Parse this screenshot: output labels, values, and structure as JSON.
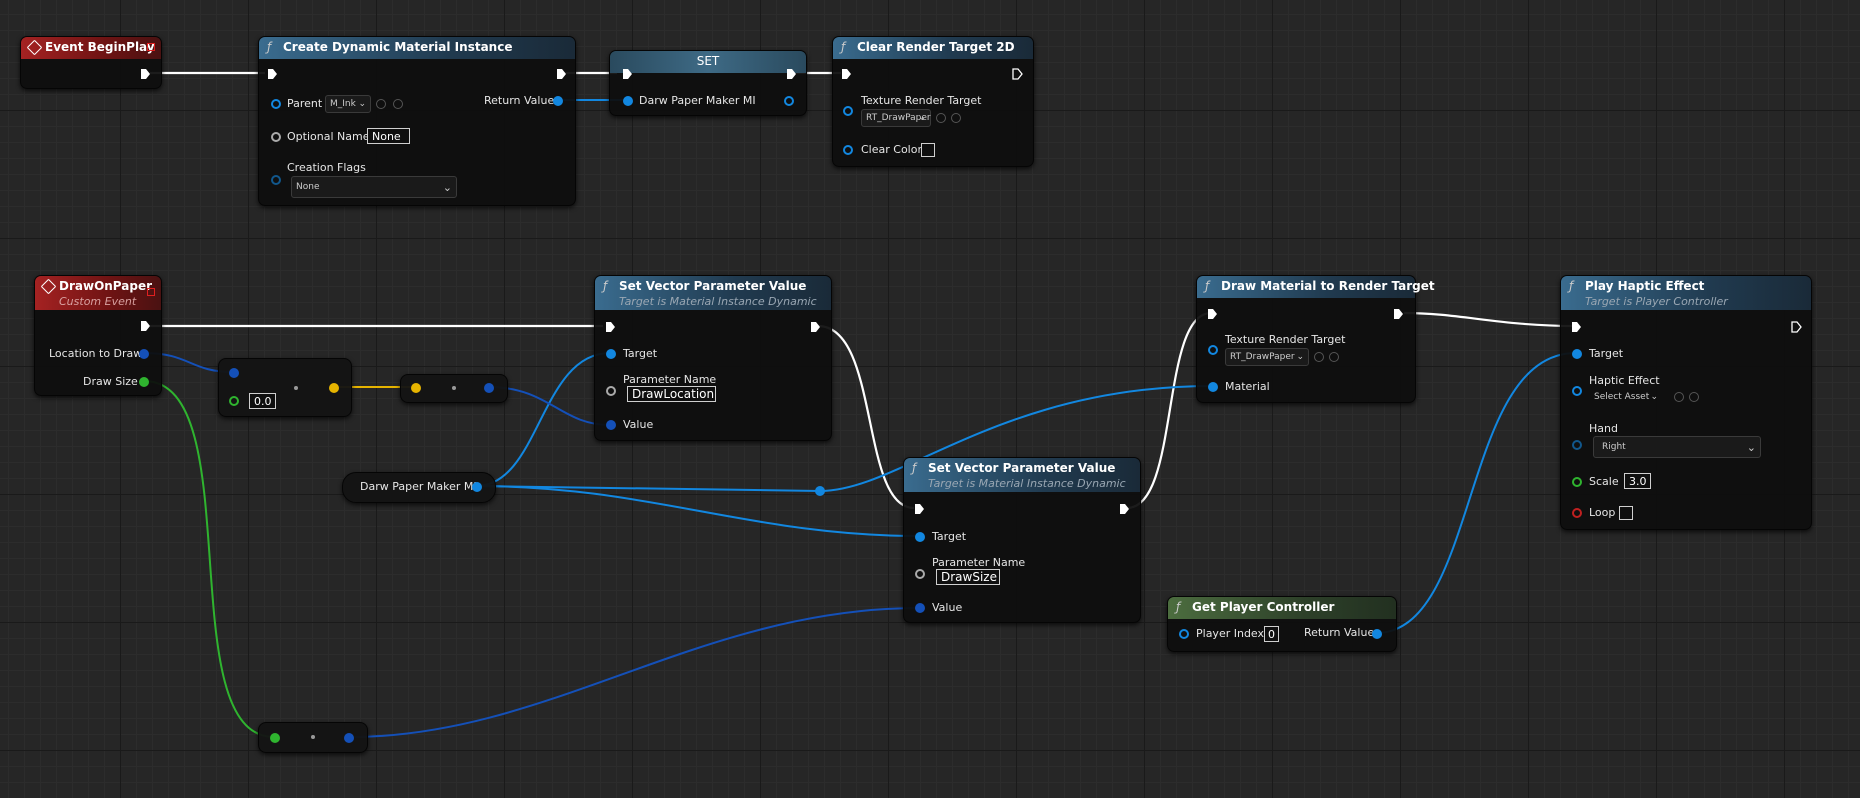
{
  "nodes": {
    "event_beginplay": {
      "title": "Event BeginPlay"
    },
    "create_dmi": {
      "title": "Create Dynamic Material Instance",
      "parent_label": "Parent",
      "parent_value": "M_Ink",
      "optional_name_label": "Optional Name",
      "optional_name_value": "None",
      "creation_flags_label": "Creation Flags",
      "creation_flags_value": "None",
      "return_value_label": "Return Value"
    },
    "set_var": {
      "title": "SET",
      "var_label": "Darw Paper Maker MI"
    },
    "clear_rt": {
      "title": "Clear Render Target 2D",
      "texture_label": "Texture Render Target",
      "texture_value": "RT_DrawPaper",
      "clear_color_label": "Clear Color"
    },
    "draw_on_paper": {
      "title": "DrawOnPaper",
      "subtitle": "Custom Event",
      "location_label": "Location to Draw",
      "size_label": "Draw Size"
    },
    "make_vec": {
      "value": "0.0"
    },
    "set_vec_1": {
      "title": "Set Vector Parameter Value",
      "subtitle": "Target is Material Instance Dynamic",
      "target_label": "Target",
      "param_name_label": "Parameter Name",
      "param_name_value": "DrawLocation",
      "value_label": "Value"
    },
    "var_get": {
      "label": "Darw Paper Maker MI"
    },
    "set_vec_2": {
      "title": "Set Vector Parameter Value",
      "subtitle": "Target is Material Instance Dynamic",
      "target_label": "Target",
      "param_name_label": "Parameter Name",
      "param_name_value": "DrawSize",
      "value_label": "Value"
    },
    "draw_mat": {
      "title": "Draw Material to Render Target",
      "texture_label": "Texture Render Target",
      "texture_value": "RT_DrawPaper",
      "material_label": "Material"
    },
    "haptic": {
      "title": "Play Haptic Effect",
      "subtitle": "Target is Player Controller",
      "target_label": "Target",
      "effect_label": "Haptic Effect",
      "effect_value": "Select Asset",
      "hand_label": "Hand",
      "hand_value": "Right",
      "scale_label": "Scale",
      "scale_value": "3.0",
      "loop_label": "Loop"
    },
    "get_pc": {
      "title": "Get Player Controller",
      "player_index_label": "Player Index",
      "player_index_value": "0",
      "return_value_label": "Return Value"
    }
  },
  "colors": {
    "exec": "#ffffff",
    "object": "#1287e0",
    "vector": "#1450b8",
    "float": "#2fb42f",
    "struct": "#e6b400",
    "bool": "#c02020"
  },
  "icons": [
    "event-icon",
    "function-icon",
    "exec-pin-icon",
    "data-pin-icon",
    "dropdown-chevron-icon",
    "browse-icon",
    "use-asset-icon"
  ]
}
